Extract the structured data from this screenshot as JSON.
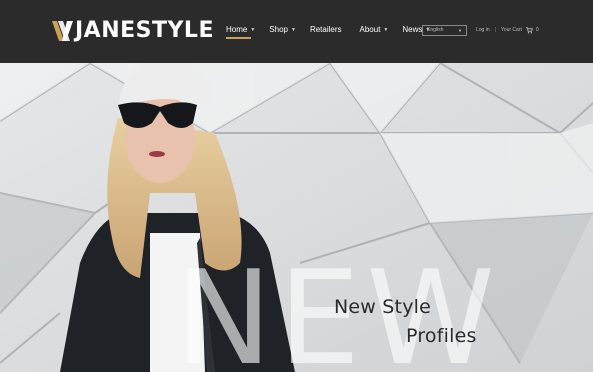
{
  "brand": {
    "name": "JANESTYLE",
    "icon": "logo-mark-icon"
  },
  "nav": {
    "items": [
      {
        "label": "Home",
        "has_dropdown": true,
        "active": true
      },
      {
        "label": "Shop",
        "has_dropdown": true,
        "active": false
      },
      {
        "label": "Retailers",
        "has_dropdown": false,
        "active": false
      },
      {
        "label": "About",
        "has_dropdown": true,
        "active": false
      },
      {
        "label": "News",
        "has_dropdown": true,
        "active": false
      }
    ],
    "accent_color": "#c8a25a"
  },
  "language": {
    "selected": "English"
  },
  "account": {
    "login_label": "Log in",
    "separator": "|",
    "cart_label": "Your Cart",
    "cart_count": "0",
    "cart_icon": "cart-icon"
  },
  "hero": {
    "line1": "New Style",
    "line2": "Profiles",
    "watermark": "NEW"
  },
  "colors": {
    "header_bg": "#2b2b2b",
    "text_dark": "#2a2a2a"
  }
}
